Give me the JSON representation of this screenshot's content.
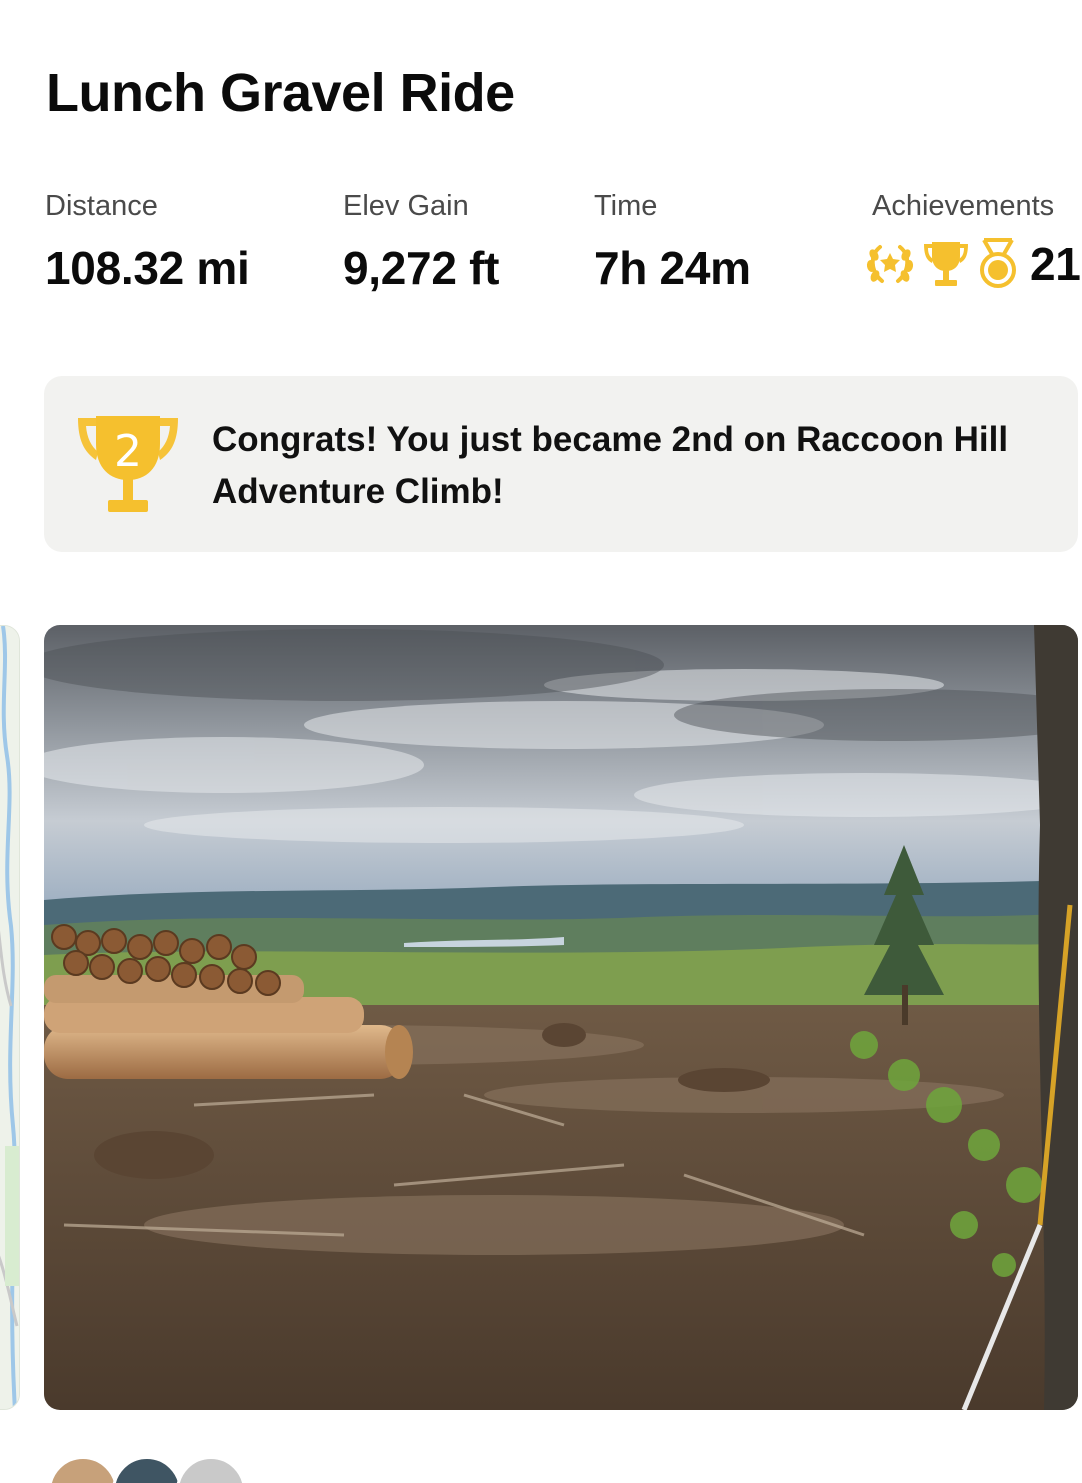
{
  "activity": {
    "title": "Lunch Gravel Ride"
  },
  "stats": [
    {
      "label": "Distance",
      "value": "108.32 mi"
    },
    {
      "label": "Elev Gain",
      "value": "9,272 ft"
    },
    {
      "label": "Time",
      "value": "7h 24m"
    },
    {
      "label": "Achievements",
      "value": "21",
      "icons": [
        "laurel-icon",
        "trophy-icon",
        "medal-icon"
      ]
    }
  ],
  "achievement_banner": {
    "rank": "2",
    "message": "Congrats! You just became 2nd on Raccoon Hill Adventure Climb!",
    "icon": "trophy-icon"
  },
  "media": {
    "photo": "landscape-photo",
    "map": "route-map-preview"
  },
  "colors": {
    "gold": "#F5C02E",
    "banner_bg": "#F2F2F0",
    "text": "#0B0B0B",
    "label": "#4A4A4A"
  }
}
